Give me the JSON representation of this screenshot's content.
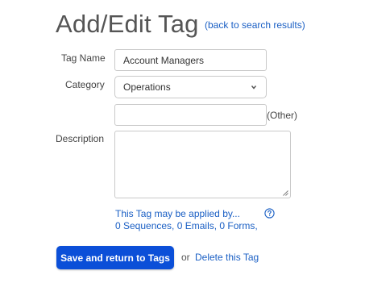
{
  "page": {
    "title": "Add/Edit Tag",
    "back_link_open": "(",
    "back_link_text": "back to search results",
    "back_link_close": ")"
  },
  "form": {
    "tag_name_label": "Tag Name",
    "tag_name_value": "Account Managers",
    "category_label": "Category",
    "category_selected": "Operations",
    "other_value": "",
    "other_label": "(Other)",
    "description_label": "Description",
    "description_value": ""
  },
  "usage": {
    "line1": "This Tag may be applied by...",
    "line2": "0 Sequences, 0 Emails, 0 Forms,"
  },
  "actions": {
    "save_label": "Save and return to Tags",
    "or_text": "or",
    "delete_label": "Delete this Tag"
  },
  "icons": {
    "category_dropdown": "chevron-down-icon",
    "help": "question-circle-icon",
    "resize": "resize-grip-icon"
  },
  "colors": {
    "primary_button": "#0b4fd8",
    "link": "#1a5fc4",
    "title": "#555555",
    "border": "#c9c9c9"
  }
}
